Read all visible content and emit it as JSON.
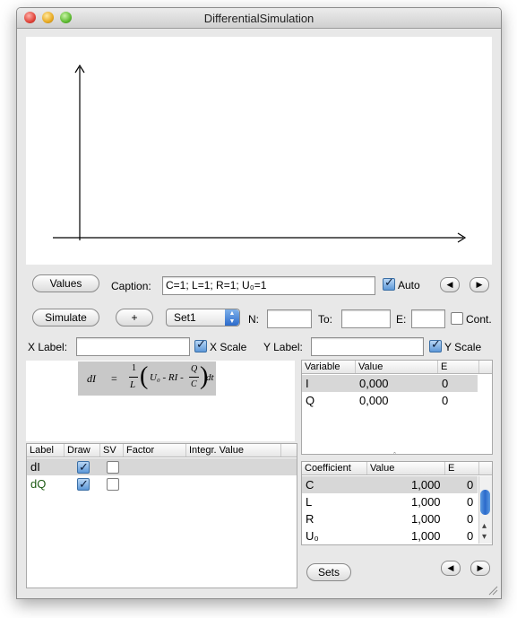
{
  "window": {
    "title": "DifferentialSimulation"
  },
  "toolbar1": {
    "values_button": "Values",
    "caption_label": "Caption:",
    "caption_value": "C=1; L=1; R=1; U₀=1",
    "auto_label": "Auto",
    "auto_checked": true
  },
  "toolbar2": {
    "simulate_button": "Simulate",
    "add_button": "+",
    "set_select": "Set1",
    "n_label": "N:",
    "to_label": "To:",
    "e_label": "E:",
    "cont_label": "Cont."
  },
  "toolbar3": {
    "xlabel_label": "X Label:",
    "xscale_label": "X Scale",
    "ylabel_label": "Y Label:",
    "yscale_label": "Y Scale",
    "xscale_checked": true,
    "yscale_checked": true
  },
  "formula": {
    "lhs": "dI",
    "eq": "=",
    "num": "1",
    "den": "L",
    "term1": "U₀ - RI -",
    "q": "Q",
    "c": "C",
    "dt": "dt"
  },
  "variables_table": {
    "headers": [
      "Variable",
      "Value",
      "E"
    ],
    "rows": [
      {
        "name": "I",
        "value": "0,000",
        "e": "0",
        "selected": true
      },
      {
        "name": "Q",
        "value": "0,000",
        "e": "0",
        "selected": false
      }
    ]
  },
  "equations_table": {
    "headers": [
      "Label",
      "Draw",
      "SV",
      "Factor",
      "Integr. Value"
    ],
    "rows": [
      {
        "label": "dI",
        "draw": true,
        "sv": false,
        "color": "#000000",
        "selected": true
      },
      {
        "label": "dQ",
        "draw": true,
        "sv": false,
        "color": "#1c5a12",
        "selected": false
      }
    ]
  },
  "coefficients_table": {
    "headers": [
      "Coefficient",
      "Value",
      "E"
    ],
    "rows": [
      {
        "name": "C",
        "value": "1,000",
        "e": "0",
        "selected": true
      },
      {
        "name": "L",
        "value": "1,000",
        "e": "0",
        "selected": false
      },
      {
        "name": "R",
        "value": "1,000",
        "e": "0",
        "selected": false
      },
      {
        "name": "U₀",
        "value": "1,000",
        "e": "0",
        "selected": false
      }
    ]
  },
  "sets_button": "Sets",
  "icons": {
    "nav_left": "◀",
    "nav_right": "▶",
    "check": "✓",
    "scroll_up": "▴",
    "scroll_down": "▾",
    "stepper_up": "▲",
    "stepper_down": "▼",
    "splitter": "ˆ"
  }
}
